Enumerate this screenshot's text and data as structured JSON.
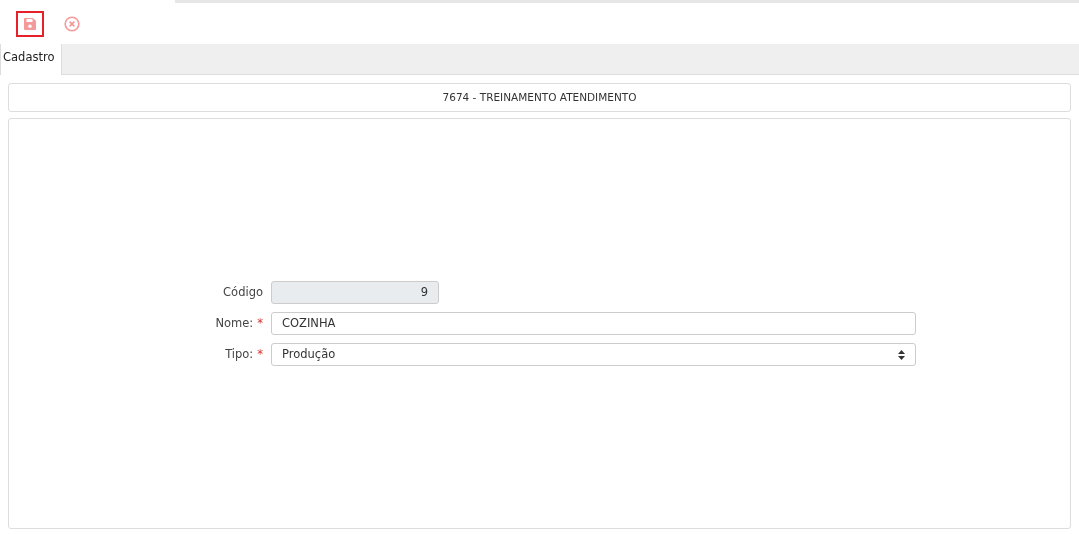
{
  "toolbar": {
    "buttons": [
      {
        "kind": "save",
        "focused": true
      },
      {
        "kind": "cancel",
        "focused": false
      }
    ]
  },
  "tabs": [
    {
      "label": "Cadastro",
      "selected": true
    }
  ],
  "title": "7674 - TREINAMENTO ATENDIMENTO",
  "fields": [
    {
      "kind": "readonly",
      "label": "Código",
      "value": "9"
    },
    {
      "kind": "text",
      "label": "Nome:",
      "required_mark": "*",
      "value": "COZINHA"
    },
    {
      "kind": "select",
      "label": "Tipo:",
      "required_mark": "*",
      "value": "Produção"
    }
  ]
}
